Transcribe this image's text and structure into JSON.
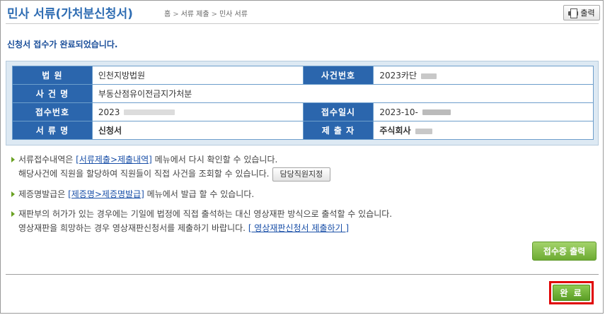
{
  "header": {
    "title": "민사 서류(가처분신청서)",
    "breadcrumb": [
      "홈",
      "서류 제출",
      "민사 서류"
    ],
    "print_label": "출력"
  },
  "message": "신청서 접수가 완료되었습니다.",
  "info": {
    "court_label": "법 원",
    "court_value": "인천지방법원",
    "case_no_label": "사건번호",
    "case_no_value": "2023카단",
    "case_name_label": "사 건 명",
    "case_name_value": "부동산점유이전금지가처분",
    "receipt_no_label": "접수번호",
    "receipt_no_value": "2023",
    "receipt_date_label": "접수일시",
    "receipt_date_value": "2023-10-",
    "doc_name_label": "서 류 명",
    "doc_name_value": "신청서",
    "submitter_label": "제 출 자",
    "submitter_value": "주식회사"
  },
  "notes": {
    "n1_pre": "서류접수내역은 ",
    "n1_link": "[서류제출>제출내역]",
    "n1_post": " 메뉴에서 다시 확인할 수 있습니다.",
    "n1_line2": "해당사건에 직원을 할당하여 직원들이 직접 사건을 조회할 수 있습니다.",
    "assign_button": "담당직원지정",
    "n2_pre": "제증명발급은 ",
    "n2_link": "[제증명>제증명발급]",
    "n2_post": " 메뉴에서 발급 할 수 있습니다.",
    "n3_line1": "재판부의 허가가 있는 경우에는 기일에 법정에 직접 출석하는 대신 영상재판 방식으로 출석할 수 있습니다.",
    "n3_line2": "영상재판을 희망하는 경우 영상재판신청서를 제출하기 바랍니다.",
    "n3_link": "[ 영상재판신청서 제출하기 ]"
  },
  "buttons": {
    "receipt_print": "접수증 출력",
    "done": "완 료"
  }
}
